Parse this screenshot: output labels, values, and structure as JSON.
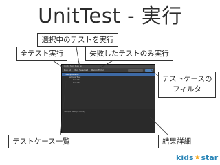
{
  "slide": {
    "title": "UnitTest - 実行",
    "callouts": {
      "run_selected": "選択中のテストを実行",
      "run_all": "全テスト実行",
      "run_failed": "失敗したテストのみ実行",
      "test_case_filter_line1": "テストケースの",
      "test_case_filter_line2": "フィルタ",
      "test_case_list": "テストケース一覧",
      "result_details": "結果詳細"
    },
    "logo": {
      "part1": "kids",
      "star": "★",
      "part2": "star"
    }
  },
  "colors": {
    "title_text": "#2b2b2b",
    "callout_border": "#333333",
    "window_bg": "#262626",
    "selection": "#3e6aa6",
    "logo_blue": "#2a86b8",
    "logo_star": "#f4a61b"
  },
  "unity_window": {
    "title": "Unity Test Runner",
    "toolbar": {
      "run_all": "Run All",
      "run_selected": "Run Selected",
      "rerun_failed": "Rerun Failed"
    },
    "tree": [
      {
        "label": "ExampleTests"
      },
      {
        "label": "SampleTest"
      },
      {
        "label": "Case01"
      },
      {
        "label": "Case02"
      }
    ],
    "detail": "SampleTest (0.001s)"
  }
}
